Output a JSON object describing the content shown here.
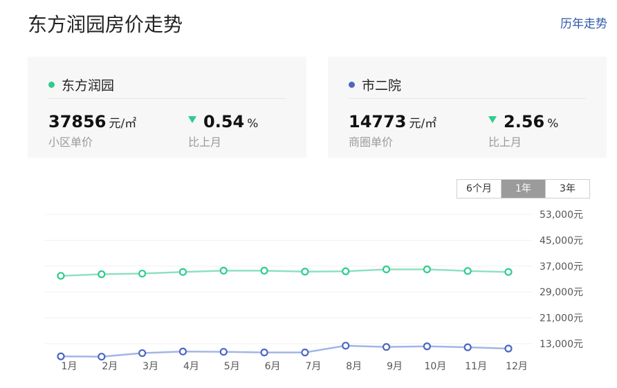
{
  "header": {
    "title": "东方润园房价走势",
    "history_link": "历年走势"
  },
  "cards": [
    {
      "name": "东方润园",
      "dot_color": "#2ecc8e",
      "price": "37856",
      "price_unit": "元/㎡",
      "price_label": "小区单价",
      "change": "0.54",
      "change_unit": "%",
      "change_label": "比上月"
    },
    {
      "name": "市二院",
      "dot_color": "#4a67c2",
      "price": "14773",
      "price_unit": "元/㎡",
      "price_label": "商圈单价",
      "change": "2.56",
      "change_unit": "%",
      "change_label": "比上月"
    }
  ],
  "range_tabs": {
    "items": [
      "6个月",
      "1年",
      "3年"
    ],
    "active": "1年"
  },
  "chart_data": {
    "type": "line",
    "categories": [
      "1月",
      "2月",
      "3月",
      "4月",
      "5月",
      "6月",
      "7月",
      "8月",
      "9月",
      "10月",
      "11月",
      "12月"
    ],
    "y_ticks": [
      "53,000元",
      "45,000元",
      "37,000元",
      "29,000元",
      "21,000元",
      "13,000元"
    ],
    "y_tick_values": [
      53000,
      45000,
      37000,
      29000,
      21000,
      13000
    ],
    "ylim": [
      5000,
      53000
    ],
    "grid": true,
    "series": [
      {
        "color": "#8fe0c0",
        "marker_color": "#2ecc8e",
        "values": [
          34000,
          34500,
          34700,
          35200,
          35600,
          35600,
          35300,
          35400,
          36000,
          36000,
          35500,
          35200
        ]
      },
      {
        "color": "#a3b4e6",
        "marker_color": "#4a67c2",
        "values": [
          9100,
          9000,
          10100,
          10600,
          10500,
          10300,
          10300,
          12400,
          12000,
          12200,
          11900,
          11500
        ]
      }
    ]
  }
}
